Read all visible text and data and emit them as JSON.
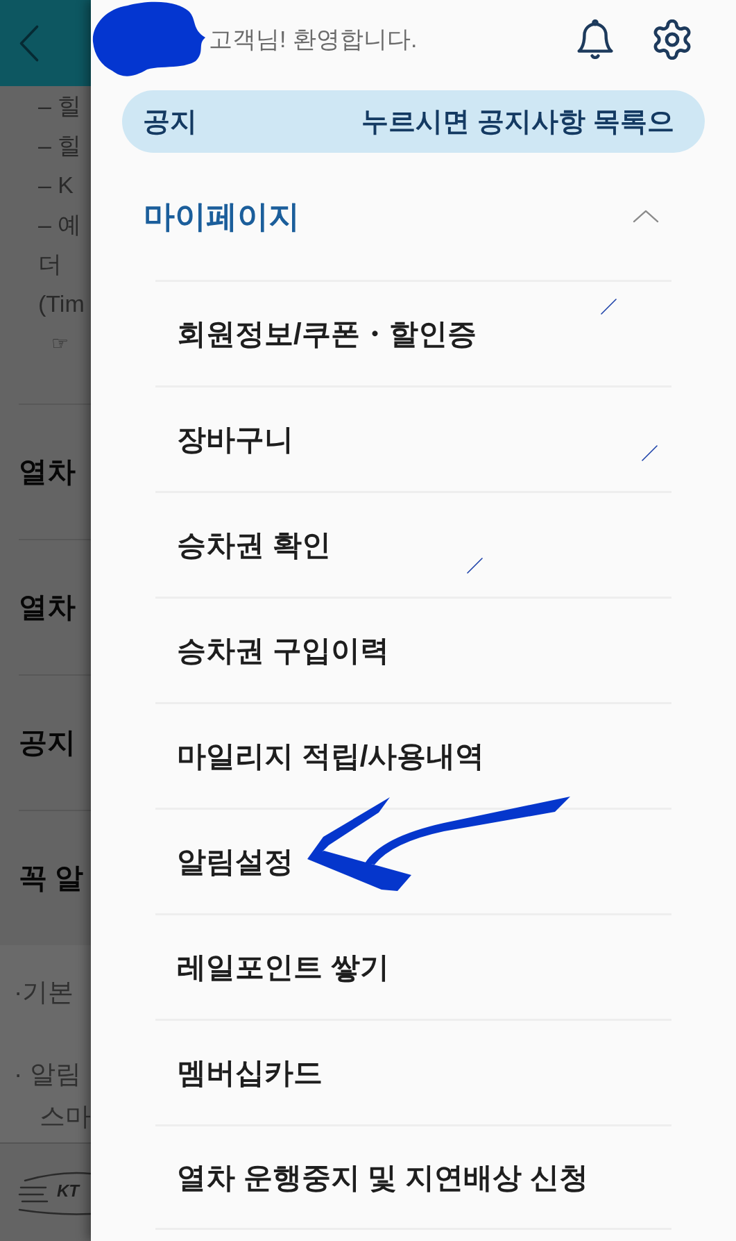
{
  "background_page": {
    "note_lines": [
      {
        "kind": "text",
        "text": "– 힐"
      },
      {
        "kind": "text",
        "text": "– 힐"
      },
      {
        "kind": "text",
        "text": "– K"
      },
      {
        "kind": "text",
        "text": "– 예"
      },
      {
        "kind": "text",
        "text": "더"
      },
      {
        "kind": "text",
        "text": "(Tim"
      },
      {
        "kind": "pointer",
        "text": "☞"
      }
    ],
    "sections": [
      "열차",
      "열차",
      "공지",
      "꼭 알"
    ],
    "bullets": [
      {
        "lines": [
          "·기본"
        ]
      },
      {
        "lines": [
          "· 알림",
          "스마"
        ]
      }
    ],
    "logo": {
      "text": "KT"
    }
  },
  "drawer": {
    "greeting": "고객님! 환영합니다.",
    "notice": {
      "label": "공지",
      "message": "누르시면 공지사항 목록으"
    },
    "menu": {
      "title": "마이페이지",
      "expanded": true,
      "items": [
        "회원정보/쿠폰・할인증",
        "장바구니",
        "승차권 확인",
        "승차권 구입이력",
        "마일리지 적립/사용내역",
        "알림설정",
        "레일포인트 쌓기",
        "멤버십카드",
        "열차 운행중지 및 지연배상 신청"
      ]
    }
  }
}
